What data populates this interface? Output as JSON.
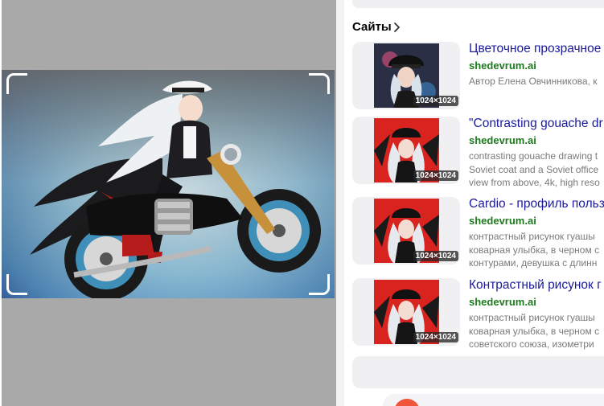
{
  "preview": {
    "description_icon": "anime-motorcycle-rider-image",
    "background_color": "#a9a9a9"
  },
  "sites_section": {
    "title": "Сайты",
    "chevron_icon": "chevron-right-icon"
  },
  "results": [
    {
      "title": "Цветочное прозрачное",
      "host": "shedevrum.ai",
      "size": "1024×1024",
      "snippet": [
        "Автор Елена Овчинникова, к"
      ],
      "thumb_style": "dark"
    },
    {
      "title": "\"Contrasting gouache dr",
      "host": "shedevrum.ai",
      "size": "1024×1024",
      "snippet": [
        "contrasting gouache drawing t",
        "Soviet coat and a Soviet office",
        "view from above, 4k, high reso"
      ],
      "thumb_style": "red"
    },
    {
      "title": "Cardio - профиль польз",
      "host": "shedevrum.ai",
      "size": "1024×1024",
      "snippet": [
        "контрастный рисунок гуашы",
        "коварная улыбка, в черном с",
        "контурами, девушка с длинн"
      ],
      "thumb_style": "red"
    },
    {
      "title": "Контрастный рисунок г",
      "host": "shedevrum.ai",
      "size": "1024×1024",
      "snippet": [
        "контрастный рисунок гуашы",
        "коварная улыбка, в черном с",
        "советского союза, изометри"
      ],
      "thumb_style": "red"
    }
  ],
  "colors": {
    "link_title": "#1a1a9c",
    "host_green": "#1f7a1f",
    "snippet_gray": "#7a7a7a",
    "accent_orange": "#f0543a"
  }
}
